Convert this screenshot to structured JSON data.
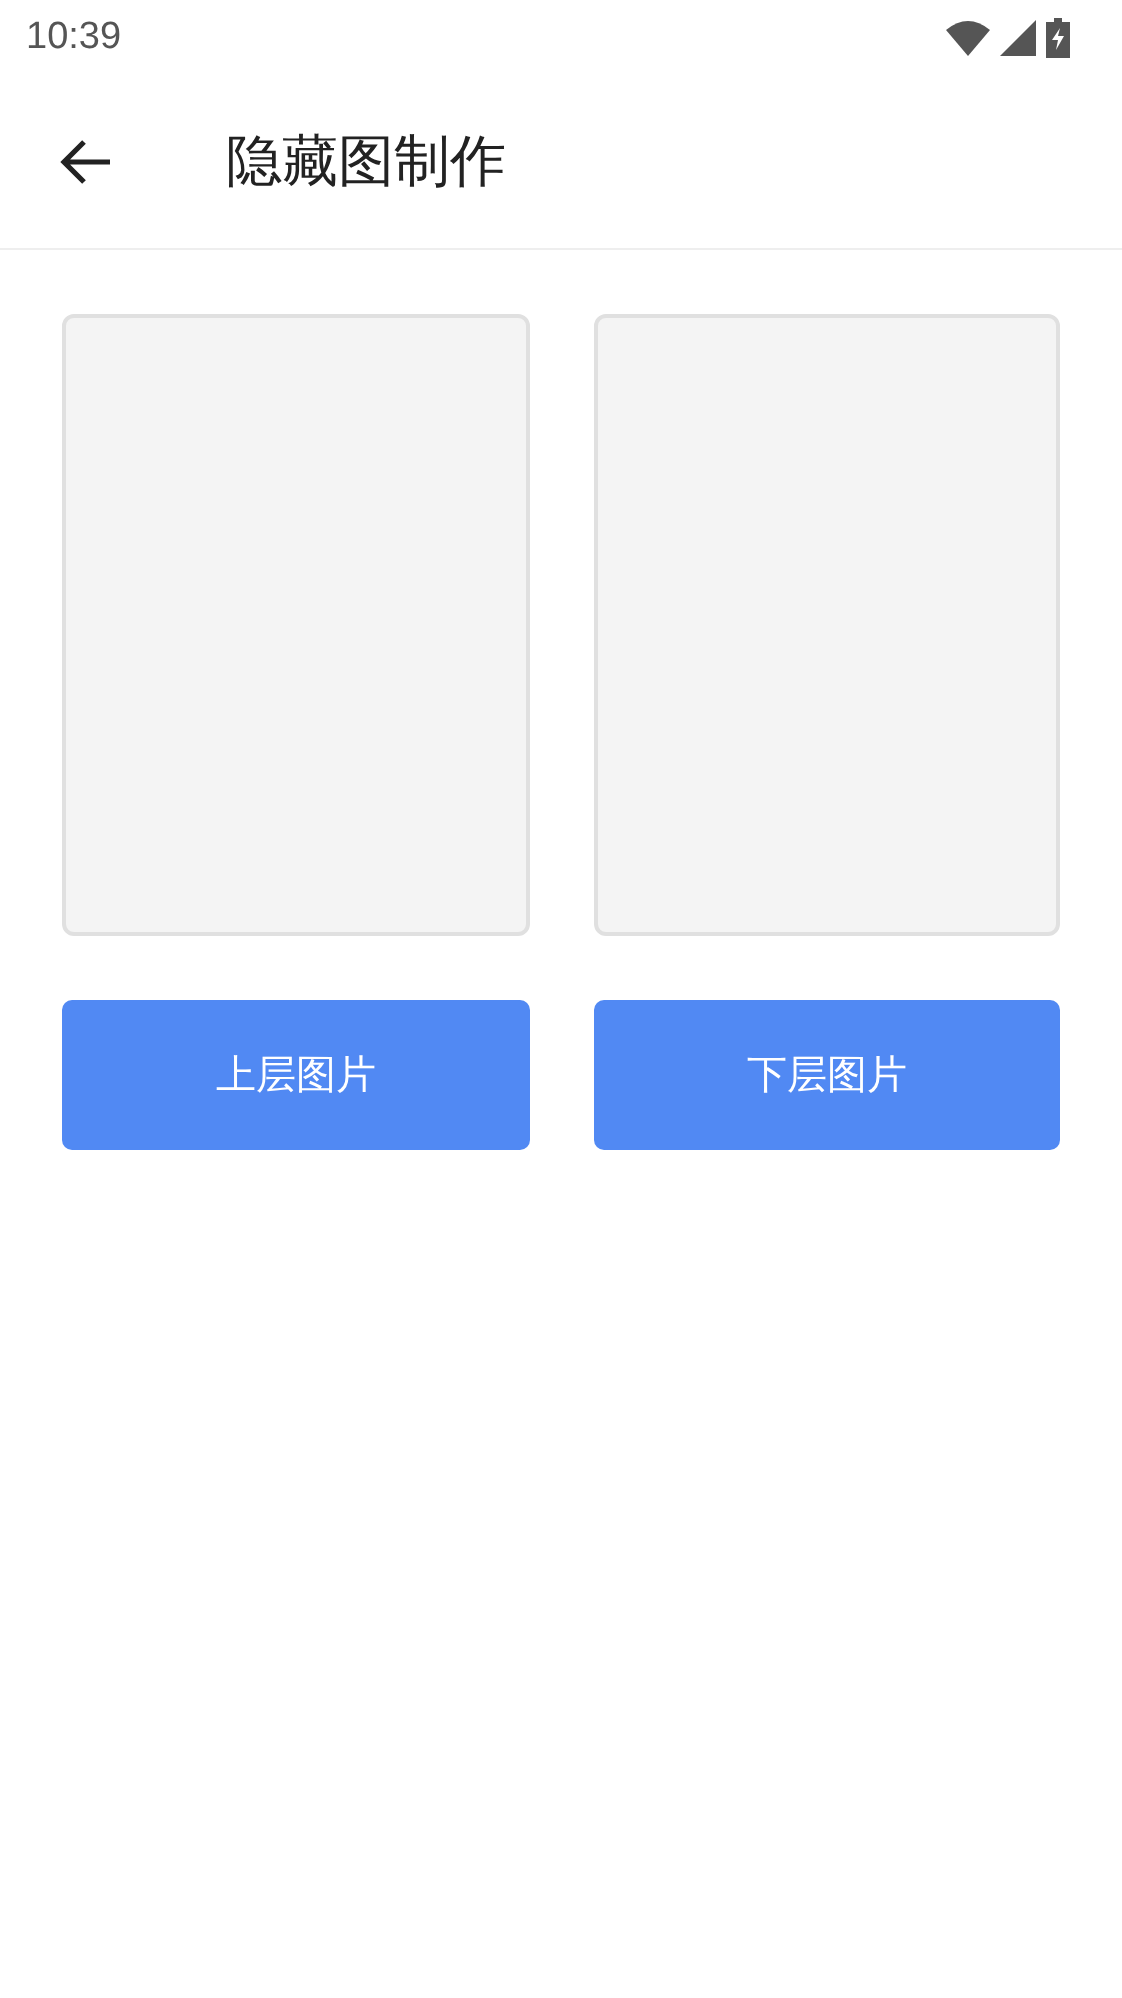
{
  "status_bar": {
    "time": "10:39"
  },
  "app_bar": {
    "title": "隐藏图制作"
  },
  "slots": [
    {
      "button": "上层图片"
    },
    {
      "button": "下层图片"
    }
  ]
}
